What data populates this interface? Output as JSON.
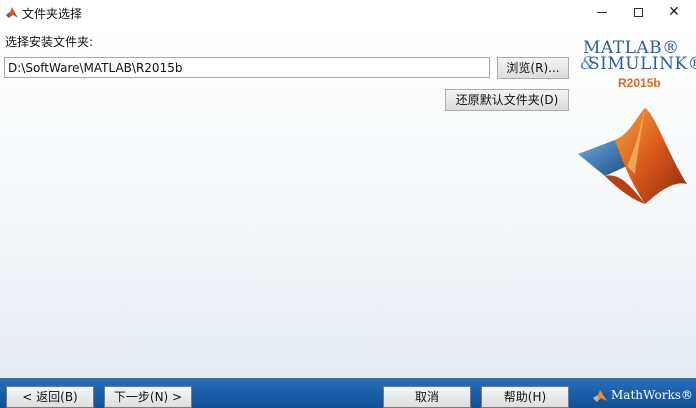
{
  "window": {
    "title": "文件夹选择",
    "minimize_label": "—",
    "maximize_label": "□",
    "close_label": "✕"
  },
  "main": {
    "install_label": "选择安装文件夹:",
    "path_value": "D:\\SoftWare\\MATLAB\\R2015b",
    "browse_button": "浏览(R)...",
    "restore_button": "还原默认文件夹(D)"
  },
  "logo": {
    "line1": "MATLAB®",
    "line2": "SIMULINK®",
    "amp": "&",
    "version": "R2015b",
    "icon": "matlab-membrane-icon"
  },
  "footer": {
    "back_button": "< 返回(B)",
    "next_button": "下一步(N) >",
    "cancel_button": "取消",
    "help_button": "帮助(H)",
    "mathworks_text": "MathWorks®"
  },
  "colors": {
    "footer_blue": "#1a5fa8",
    "logo_blue": "#2b5f9e",
    "version_orange": "#e06a1b"
  }
}
